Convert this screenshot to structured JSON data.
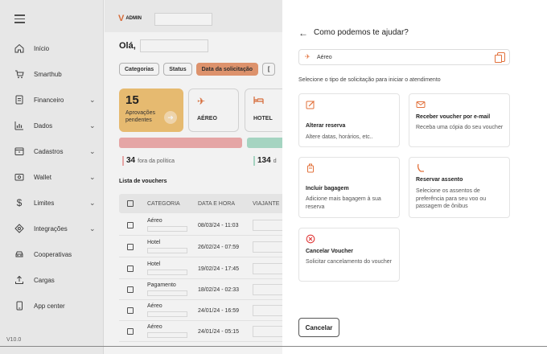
{
  "sidebar": {
    "items": [
      {
        "label": "Início",
        "icon": "home-icon",
        "chevron": ""
      },
      {
        "label": "Smarthub",
        "icon": "cart-icon",
        "chevron": ""
      },
      {
        "label": "Financeiro",
        "icon": "document-icon",
        "chevron": "⌄"
      },
      {
        "label": "Dados",
        "icon": "chart-icon",
        "chevron": "⌄"
      },
      {
        "label": "Cadastros",
        "icon": "folder-icon",
        "chevron": "⌄"
      },
      {
        "label": "Wallet",
        "icon": "wallet-icon",
        "chevron": "⌄"
      },
      {
        "label": "Limites",
        "icon": "dollar-icon",
        "chevron": "⌄"
      },
      {
        "label": "Integrações",
        "icon": "integration-icon",
        "chevron": "⌄"
      },
      {
        "label": "Cooperativas",
        "icon": "car-icon",
        "chevron": ""
      },
      {
        "label": "Cargas",
        "icon": "upload-icon",
        "chevron": ""
      },
      {
        "label": "App center",
        "icon": "phone-icon",
        "chevron": ""
      }
    ],
    "version": "V10.0"
  },
  "header": {
    "logo_mark": "V",
    "logo_text": "ADMIN"
  },
  "main": {
    "greeting": "Olá,",
    "filters": [
      "Categorias",
      "Status",
      "Data da solicitação"
    ],
    "approvals": {
      "count": "15",
      "label": "Aprovações pendentes"
    },
    "cards": [
      {
        "label": "AÉREO",
        "icon": "airplane-icon"
      },
      {
        "label": "HOTEL",
        "icon": "bed-icon"
      }
    ],
    "stats": [
      {
        "value": "34",
        "label": "fora da política"
      },
      {
        "value": "134",
        "label": "d"
      }
    ],
    "list_title": "Lista de vouchers",
    "table": {
      "headers": [
        "CATEGORIA",
        "DATA E HORA",
        "VIAJANTE"
      ],
      "rows": [
        {
          "category": "Aéreo",
          "datetime": "08/03/24 - 11:03"
        },
        {
          "category": "Hotel",
          "datetime": "26/02/24 - 07:59"
        },
        {
          "category": "Hotel",
          "datetime": "19/02/24 - 17:45"
        },
        {
          "category": "Pagamento",
          "datetime": "18/02/24 - 02:33"
        },
        {
          "category": "Aéreo",
          "datetime": "24/01/24 - 16:59"
        },
        {
          "category": "Aéreo",
          "datetime": "24/01/24 - 05:15"
        }
      ]
    }
  },
  "drawer": {
    "back_icon": "arrow-left-icon",
    "title": "Como podemos te ajudar?",
    "selected": {
      "icon": "airplane-icon",
      "text": "Aéreo",
      "action_icon": "copy-icon"
    },
    "hint": "Selecione o tipo de solicitação para iniciar o atendimento",
    "options": [
      {
        "icon": "edit-icon",
        "title": "Alterar reserva",
        "desc": "Altere datas, horários, etc.."
      },
      {
        "icon": "mail-icon",
        "title": "Receber voucher por e-mail",
        "desc": "Receba uma cópia do seu voucher"
      },
      {
        "icon": "luggage-icon",
        "title": "Incluir bagagem",
        "desc": "Adicione mais bagagem à sua reserva"
      },
      {
        "icon": "seat-icon",
        "title": "Reservar assento",
        "desc": "Selecione os assentos de preferência para seu voo ou passagem de ônibus"
      },
      {
        "icon": "cancel-circle-icon",
        "title": "Cancelar Voucher",
        "desc": "Solicitar cancelamento do voucher"
      }
    ],
    "cancel_label": "Cancelar"
  },
  "colors": {
    "accent": "#e2703a",
    "approval_card": "#f3c477",
    "active_chip": "#e99a72",
    "bar_red": "#f2aeae",
    "bar_green": "#aee0cc"
  }
}
